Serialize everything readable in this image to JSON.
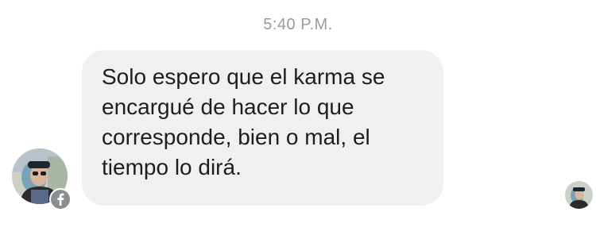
{
  "conversation": {
    "timestamp": "5:40 P.M.",
    "messages": [
      {
        "text": "Solo espero que el karma se\nencargué de hacer lo que\ncorresponde, bien o mal, el\ntiempo lo dirá."
      }
    ]
  },
  "sender": {
    "avatar_icon": "user-avatar-photo",
    "badge_icon": "facebook-icon"
  },
  "read_receipt": {
    "icon": "seen-avatar-icon"
  },
  "colors": {
    "bubble": "#f1f0f0",
    "timestamp": "#9a9a9f",
    "text": "#1c1e21",
    "badge": "#8a8d91"
  }
}
